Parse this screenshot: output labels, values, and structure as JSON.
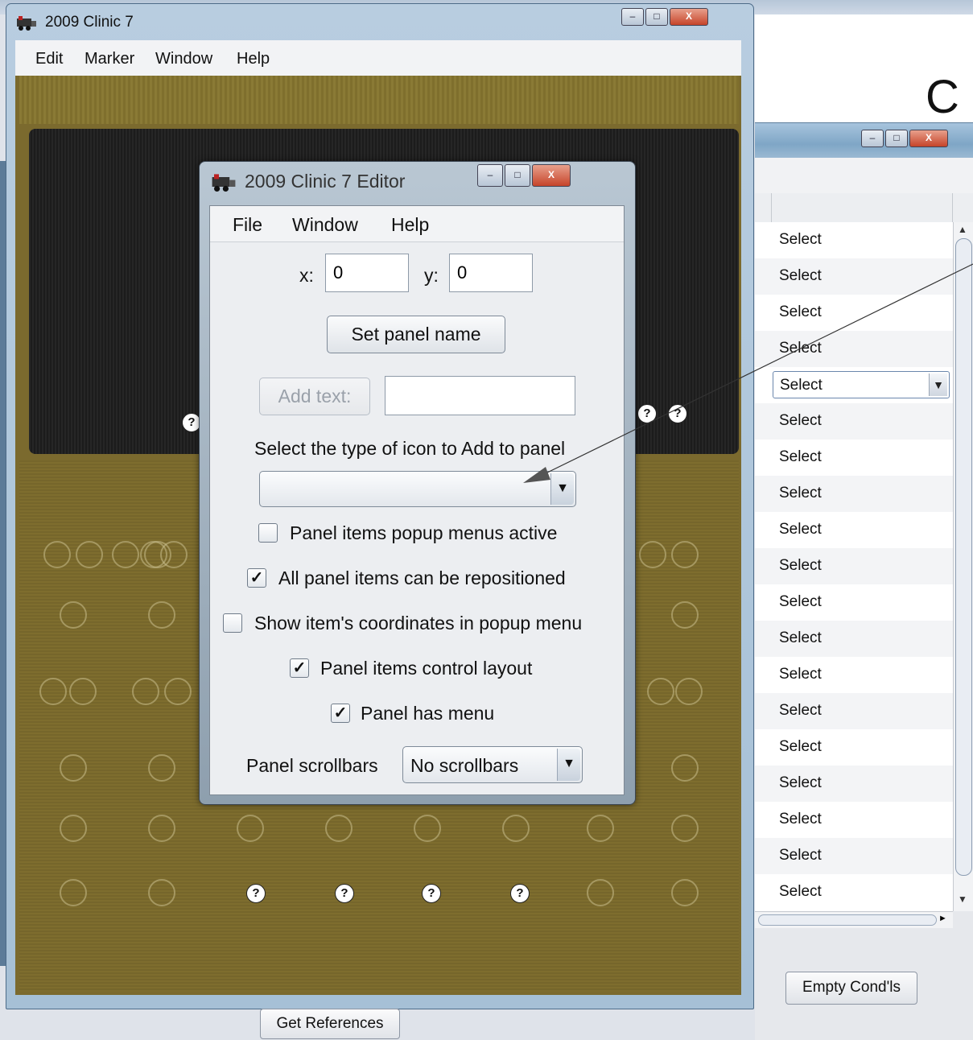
{
  "main_window": {
    "title": "2009 Clinic 7",
    "menu": [
      "Edit",
      "Marker",
      "Window",
      "Help"
    ],
    "bottom_button": "Get References"
  },
  "editor": {
    "title": "2009 Clinic 7 Editor",
    "menu": [
      "File",
      "Window",
      "Help"
    ],
    "x_label": "x:",
    "x_value": "0",
    "y_label": "y:",
    "y_value": "0",
    "set_panel_name": "Set panel name",
    "add_text": "Add text:",
    "add_text_value": "",
    "icon_type_label": "Select the type of icon to Add to panel",
    "icon_type_value": "",
    "checkboxes": [
      {
        "label": "Panel items popup menus active",
        "checked": false
      },
      {
        "label": "All panel items can be repositioned",
        "checked": true
      },
      {
        "label": "Show item's coordinates in popup menu",
        "checked": false
      },
      {
        "label": "Panel items control layout",
        "checked": true
      },
      {
        "label": "Panel has menu",
        "checked": true
      }
    ],
    "scrollbars_label": "Panel scrollbars",
    "scrollbars_value": "No scrollbars"
  },
  "right_window": {
    "partial_title": "C",
    "select_rows": [
      "Select",
      "Select",
      "Select",
      "Select",
      "Select",
      "Select",
      "Select",
      "Select",
      "Select",
      "Select",
      "Select",
      "Select",
      "Select",
      "Select",
      "Select",
      "Select",
      "Select",
      "Select",
      "Select"
    ],
    "selected_index": 4,
    "empty_button": "Empty Cond'ls"
  },
  "icons": {
    "app_icon": "locomotive-icon",
    "window_controls": [
      "minimize-icon",
      "maximize-icon",
      "close-icon"
    ],
    "unknown_icon": "question-mark-icon"
  },
  "glyphs": {
    "check": "✓",
    "down": "▼",
    "up": "▲",
    "right": "►",
    "question": "?",
    "minimize": "–",
    "maximize": "□",
    "close": "X"
  }
}
